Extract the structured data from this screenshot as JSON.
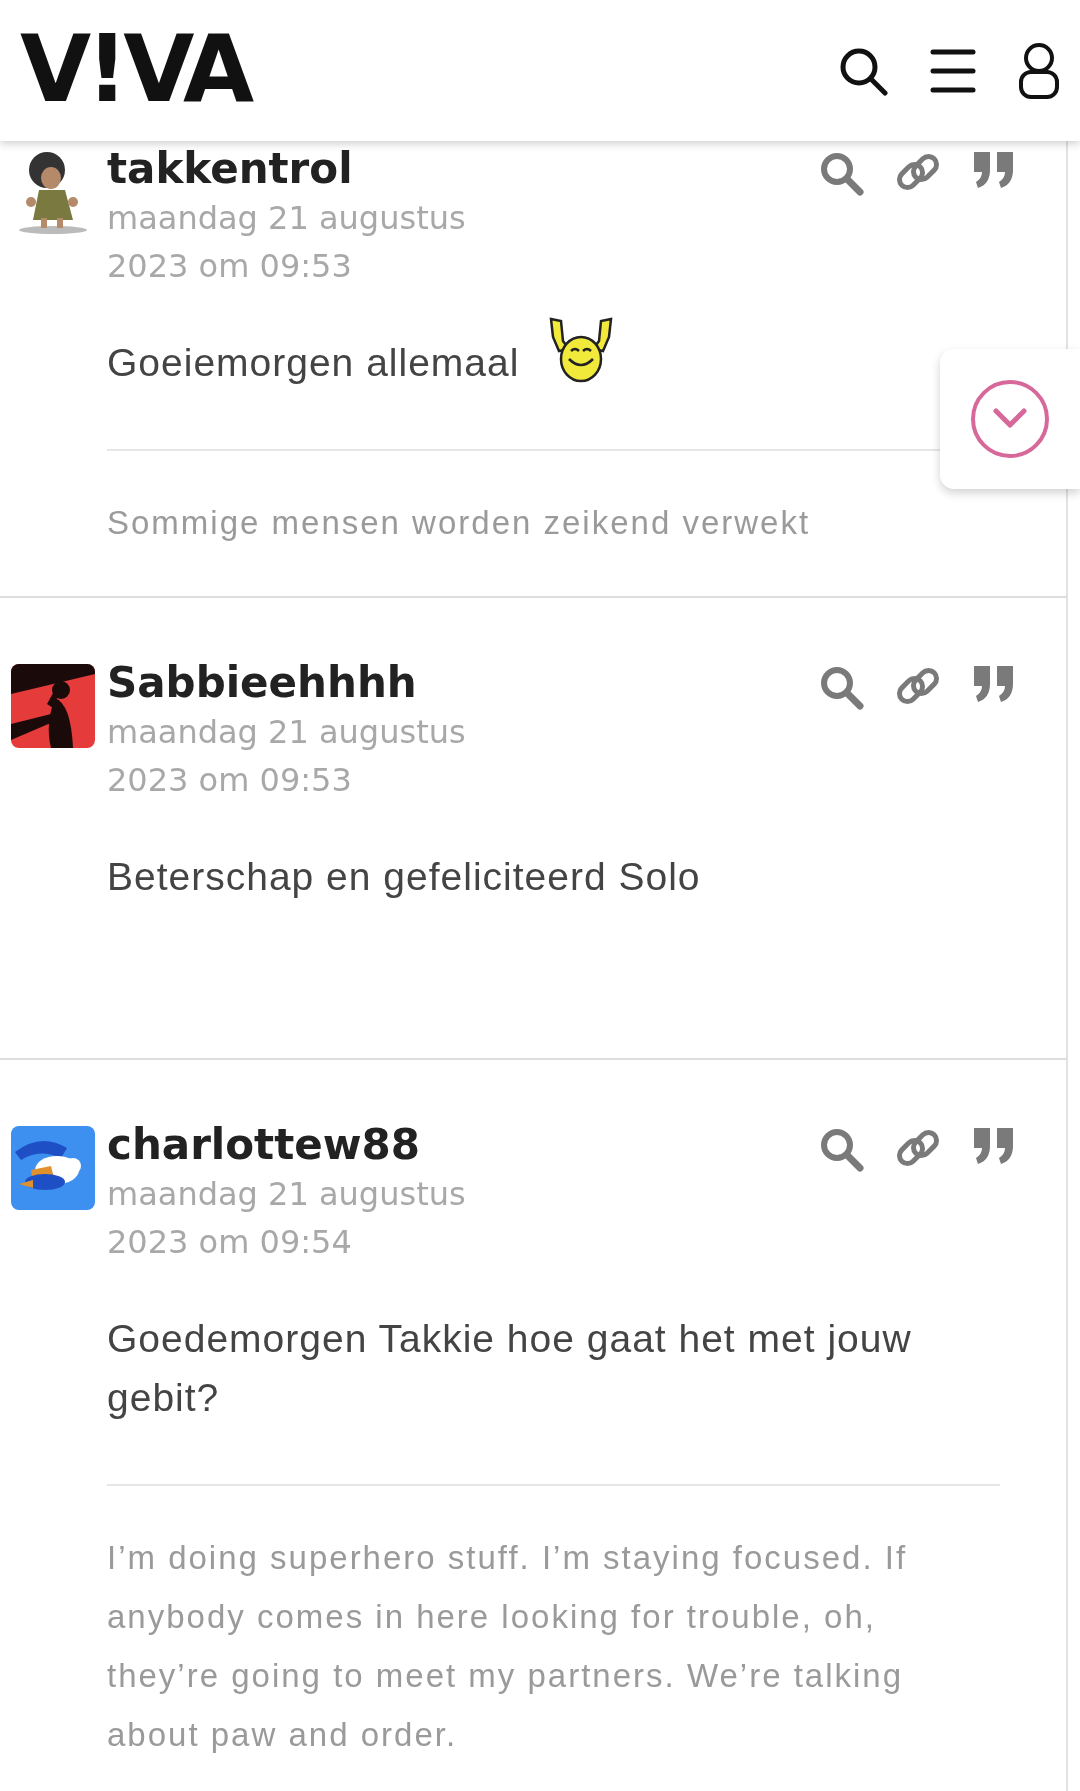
{
  "header": {
    "logo": "V!VA"
  },
  "posts": [
    {
      "author": "takkentrol",
      "date": "maandag 21 augustus 2023 om 09:53",
      "body": "Goeiemorgen allemaal",
      "emoticon": true,
      "signature": "Sommige mensen worden zeikend verwekt"
    },
    {
      "author": "Sabbieehhhh",
      "date": "maandag 21 augustus 2023 om 09:53",
      "body": "Beterschap en gefeliciteerd Solo",
      "emoticon": false
    },
    {
      "author": "charlottew88",
      "date": "maandag 21 augustus 2023 om 09:54",
      "body": "Goedemorgen Takkie hoe gaat het met jouw gebit?",
      "emoticon": false,
      "signature": "I’m doing superhero stuff. I’m staying focused. If anybody comes in here looking for trouble, oh, they’re going to meet my partners. We’re talking about paw and order."
    }
  ]
}
